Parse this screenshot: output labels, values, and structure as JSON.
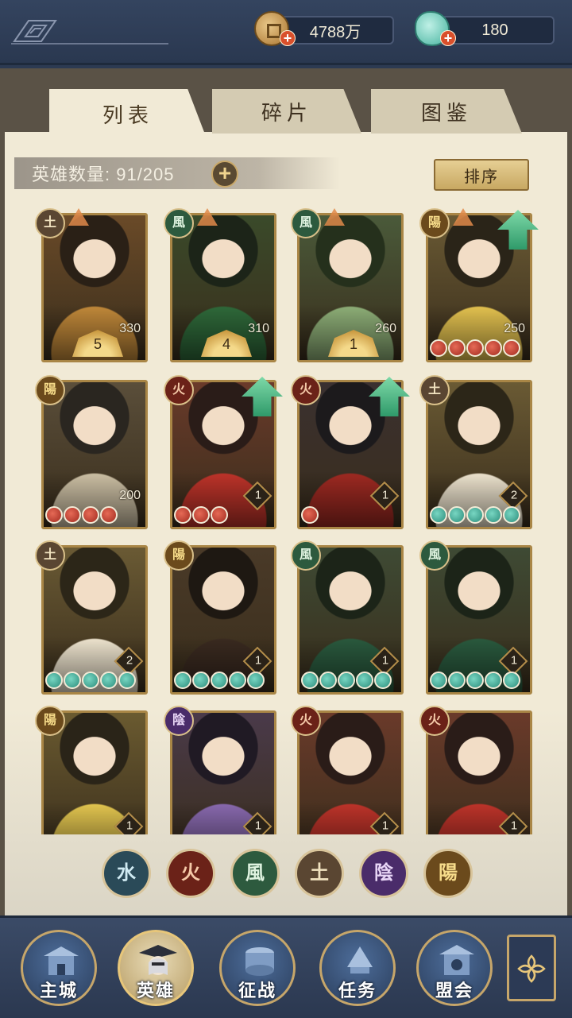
{
  "resources": {
    "coins": "4788万",
    "jade": "180"
  },
  "tabs": [
    {
      "label": "列表",
      "active": true
    },
    {
      "label": "碎片",
      "active": false
    },
    {
      "label": "图鉴",
      "active": false
    }
  ],
  "hero_count_label": "英雄数量: 91/205",
  "sort_label": "排序",
  "heroes": [
    {
      "element": "土",
      "level": "330",
      "stars": "5",
      "beads": "",
      "upgrade": false
    },
    {
      "element": "風",
      "level": "310",
      "stars": "4",
      "beads": "",
      "upgrade": false
    },
    {
      "element": "風",
      "level": "260",
      "stars": "1",
      "beads": "",
      "upgrade": false
    },
    {
      "element": "陽",
      "level": "250",
      "stars": "",
      "beads": "red5",
      "upgrade": true
    },
    {
      "element": "陽",
      "level": "200",
      "stars": "",
      "beads": "red4",
      "upgrade": false
    },
    {
      "element": "火",
      "level": "1",
      "stars": "",
      "beads": "red3",
      "upgrade": true
    },
    {
      "element": "火",
      "level": "1",
      "stars": "",
      "beads": "red1",
      "upgrade": true
    },
    {
      "element": "土",
      "level": "2",
      "stars": "",
      "beads": "teal5",
      "upgrade": false
    },
    {
      "element": "土",
      "level": "2",
      "stars": "",
      "beads": "teal5",
      "upgrade": false
    },
    {
      "element": "陽",
      "level": "1",
      "stars": "",
      "beads": "teal5",
      "upgrade": false
    },
    {
      "element": "風",
      "level": "1",
      "stars": "",
      "beads": "teal5",
      "upgrade": false
    },
    {
      "element": "風",
      "level": "1",
      "stars": "",
      "beads": "teal5",
      "upgrade": false
    },
    {
      "element": "陽",
      "level": "1",
      "stars": "",
      "beads": "",
      "upgrade": false
    },
    {
      "element": "陰",
      "level": "1",
      "stars": "",
      "beads": "",
      "upgrade": false
    },
    {
      "element": "火",
      "level": "1",
      "stars": "",
      "beads": "",
      "upgrade": false
    },
    {
      "element": "火",
      "level": "1",
      "stars": "",
      "beads": "",
      "upgrade": false
    }
  ],
  "element_filters": [
    "水",
    "火",
    "風",
    "土",
    "陰",
    "陽"
  ],
  "nav": [
    {
      "label": "主城",
      "active": false
    },
    {
      "label": "英雄",
      "active": true
    },
    {
      "label": "征战",
      "active": false
    },
    {
      "label": "任务",
      "active": false
    },
    {
      "label": "盟会",
      "active": false
    }
  ],
  "colors": {
    "panel_bg": "#f1ead6",
    "frame": "#2c3a52",
    "card_border": "#a98646",
    "upgrade_arrow": "#2f9a6a"
  }
}
